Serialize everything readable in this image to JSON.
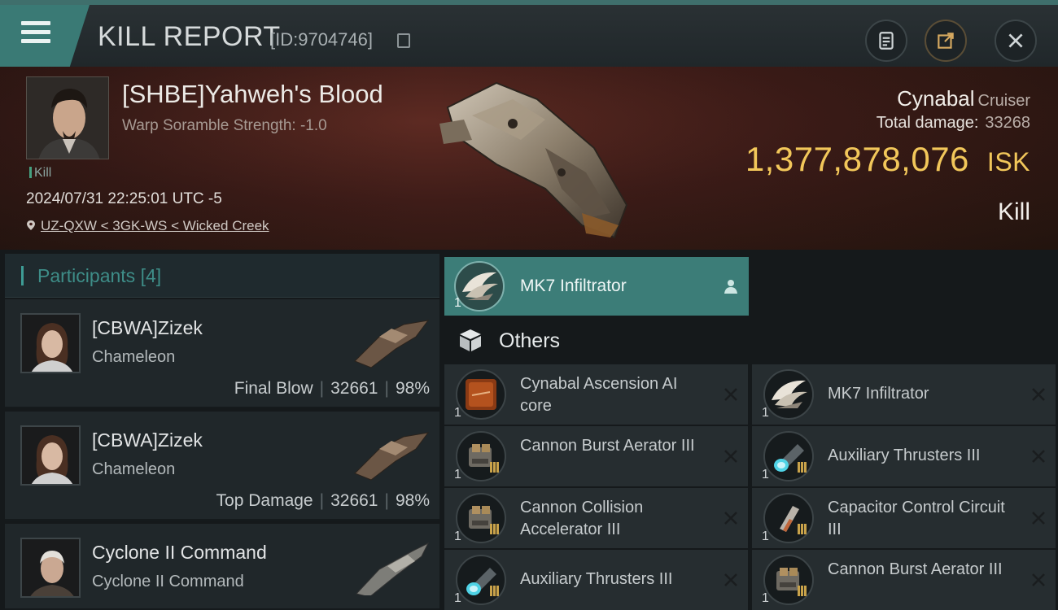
{
  "header": {
    "title": "KILL REPORT",
    "report_id": "[ID:9704746]",
    "menu_icon": "hamburger-menu-icon",
    "actions": [
      {
        "name": "report",
        "icon": "clipboard-icon"
      },
      {
        "name": "share",
        "icon": "external-share-icon"
      },
      {
        "name": "close",
        "icon": "close-icon"
      }
    ]
  },
  "victim": {
    "pilot_name": "[SHBE]Yahweh's Blood",
    "warp_scramble": "Warp Soramble Strength: -1.0",
    "kill_tag": "Kill",
    "datetime": "2024/07/31 22:25:01 UTC -5",
    "location": "UZ-QXW < 3GK-WS < Wicked Creek",
    "ship_name": "Cynabal",
    "ship_class": "Cruiser",
    "total_damage_label": "Total damage:",
    "total_damage": "33268",
    "isk_value": "1,377,878,076",
    "isk_unit": "ISK",
    "result_label": "Kill"
  },
  "participants": {
    "title": "Participants",
    "count": "[4]",
    "rows": [
      {
        "name": "[CBWA]Zizek",
        "ship": "Chameleon",
        "label": "Final Blow",
        "damage": "32661",
        "percent": "98%"
      },
      {
        "name": "[CBWA]Zizek",
        "ship": "Chameleon",
        "label": "Top Damage",
        "damage": "32661",
        "percent": "98%"
      },
      {
        "name": "Cyclone II Command",
        "ship": "Cyclone II Command",
        "label": "",
        "damage": "",
        "percent": ""
      }
    ]
  },
  "highlighted_item": {
    "name": "MK7  Infiltrator",
    "qty": "1",
    "icon": "drone-icon"
  },
  "others": {
    "title": "Others",
    "items": [
      {
        "name": "Cynabal Ascension AI core",
        "qty": "1",
        "icon": "ai-core-icon"
      },
      {
        "name": "MK7  Infiltrator",
        "qty": "1",
        "icon": "drone-icon"
      },
      {
        "name": "Cannon Burst Aerator III",
        "qty": "1",
        "icon": "module-icon"
      },
      {
        "name": "Auxiliary Thrusters III",
        "qty": "1",
        "icon": "thruster-icon"
      },
      {
        "name": "Cannon Collision Accelerator III",
        "qty": "1",
        "icon": "module-icon"
      },
      {
        "name": "Capacitor Control Circuit III",
        "qty": "1",
        "icon": "capacitor-icon"
      },
      {
        "name": "Auxiliary Thrusters III",
        "qty": "1",
        "icon": "thruster-icon"
      },
      {
        "name": "Cannon Burst Aerator III",
        "qty": "1",
        "icon": "module-icon"
      }
    ]
  },
  "colors": {
    "accent": "#3c7d78",
    "isk": "#f2c75a",
    "banner": "#4a211b"
  }
}
